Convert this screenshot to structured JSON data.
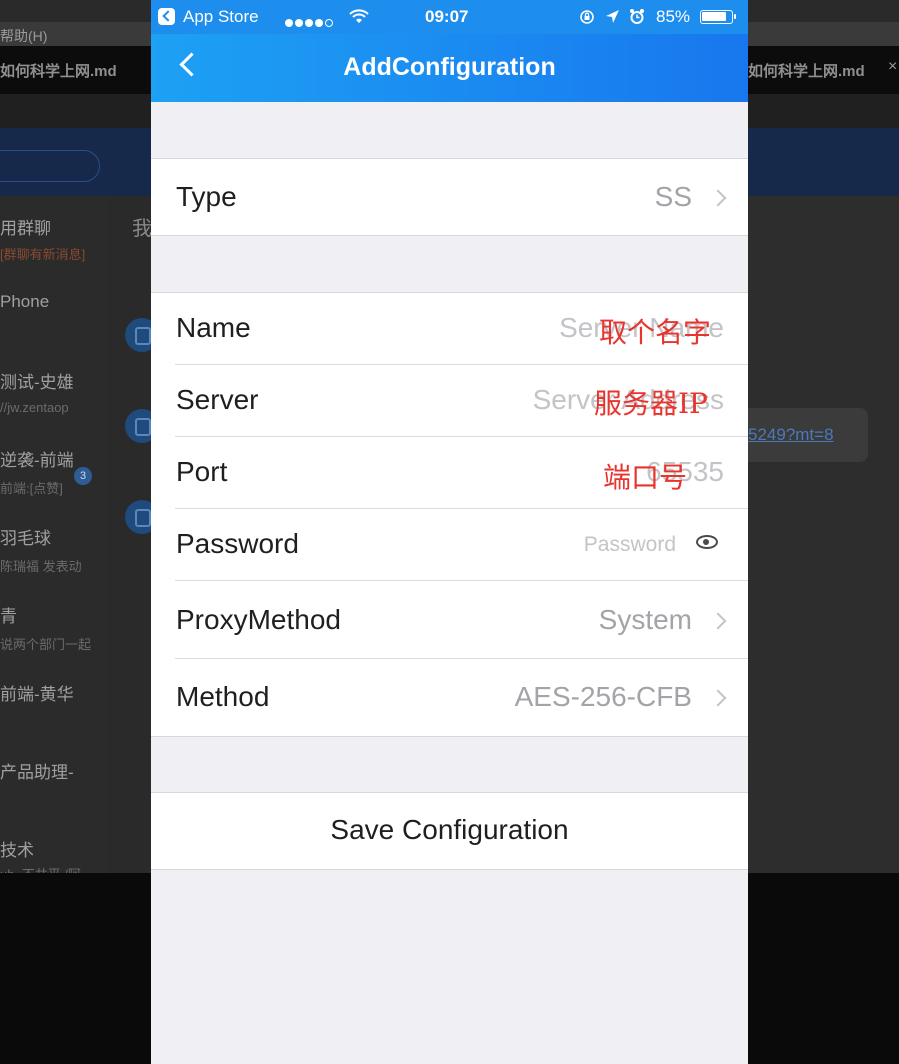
{
  "background": {
    "menu_help": "帮助(H)",
    "tab_left": "如何科学上网.md",
    "tab_right": "如何科学上网.md",
    "tab_close": "×",
    "sidebar": [
      {
        "title": "用群聊",
        "subtitle": "[群聊有新消息]"
      },
      {
        "title": "Phone",
        "subtitle": ""
      },
      {
        "title": "测试-史雄",
        "subtitle": "//jw.zentaop"
      },
      {
        "title": "逆袭-前端",
        "subtitle": "前端:[点赞]"
      },
      {
        "title": "羽毛球",
        "subtitle": "陈瑞福 发表动"
      },
      {
        "title": "青",
        "subtitle": "说两个部门一起"
      },
      {
        "title": "前端-黄华",
        "subtitle": ""
      },
      {
        "title": "产品助理-",
        "subtitle": ""
      },
      {
        "title": "技术",
        "subtitle": "ub_不共平 /阿"
      }
    ],
    "badge": "3",
    "chat_mark": "我",
    "link_text": "5249?mt=8"
  },
  "status_bar": {
    "carrier": "App Store",
    "time": "09:07",
    "battery": "85%",
    "battery_level": 0.85
  },
  "nav": {
    "title": "AddConfiguration"
  },
  "form": {
    "type": {
      "label": "Type",
      "value": "SS"
    },
    "name": {
      "label": "Name",
      "placeholder": "Server Name",
      "annotation": "取个名字"
    },
    "server": {
      "label": "Server",
      "placeholder": "Server Address",
      "annotation": "服务器IP"
    },
    "port": {
      "label": "Port",
      "placeholder": "65535",
      "annotation": "端口号"
    },
    "password": {
      "label": "Password",
      "placeholder": "Password"
    },
    "proxy_method": {
      "label": "ProxyMethod",
      "value": "System"
    },
    "method": {
      "label": "Method",
      "value": "AES-256-CFB"
    }
  },
  "save_label": "Save Configuration"
}
